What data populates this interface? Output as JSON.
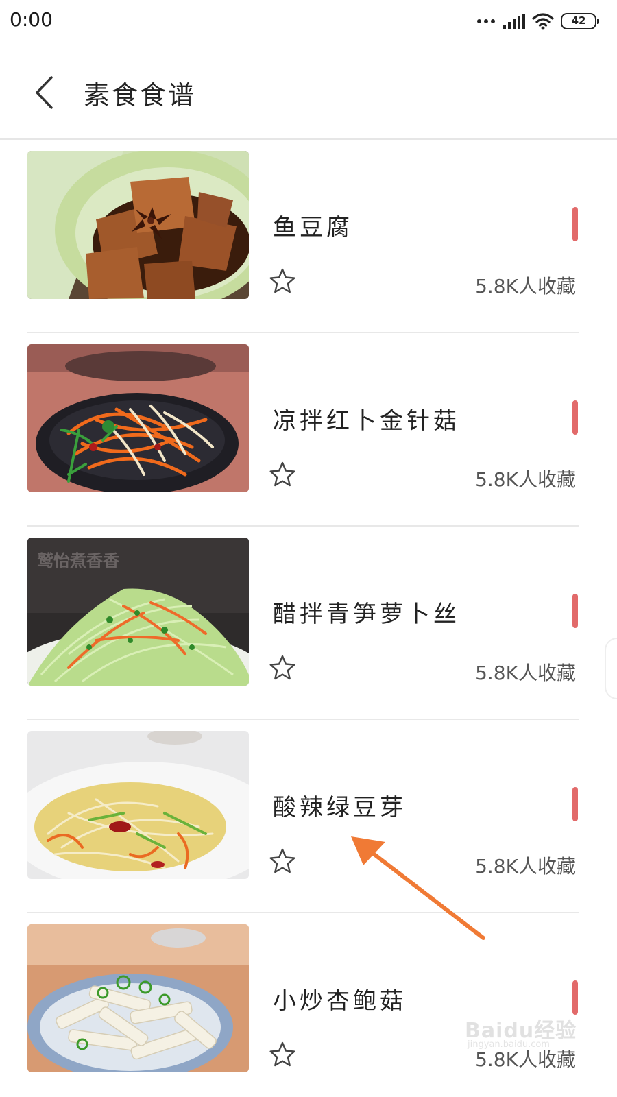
{
  "status_bar": {
    "time": "0:00",
    "battery": "42",
    "icons": [
      "more-dots-icon",
      "signal-icon",
      "wifi-icon",
      "battery-icon"
    ]
  },
  "header": {
    "back_icon": "chevron-left-icon",
    "title": "素食食谱"
  },
  "recipes": [
    {
      "name": "鱼豆腐",
      "favorites": "5.8K人收藏"
    },
    {
      "name": "凉拌红卜金针菇",
      "favorites": "5.8K人收藏"
    },
    {
      "name": "醋拌青笋萝卜丝",
      "favorites": "5.8K人收藏"
    },
    {
      "name": "酸辣绿豆芽",
      "favorites": "5.8K人收藏"
    },
    {
      "name": "小炒杏鲍菇",
      "favorites": "5.8K人收藏"
    }
  ],
  "colors": {
    "accent_marker": "#e26a6a",
    "annotation_arrow": "#f07a35",
    "divider": "#e8e8e8"
  },
  "thumbnail_watermark": "鹫怡煮香香",
  "watermark": {
    "brand": "Baidu经验",
    "sub": "jingyan.baidu.com"
  }
}
